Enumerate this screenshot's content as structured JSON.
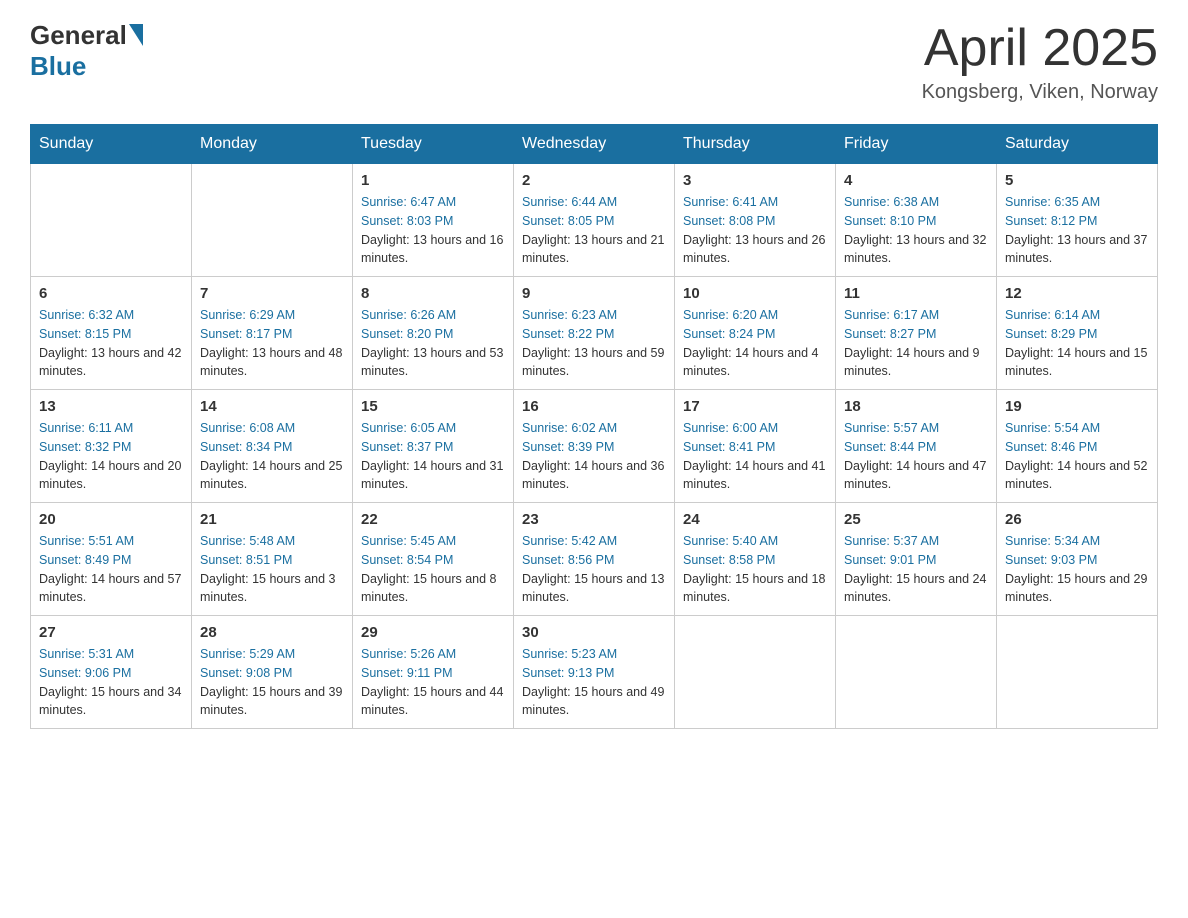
{
  "header": {
    "logo_general": "General",
    "logo_blue": "Blue",
    "month_title": "April 2025",
    "location": "Kongsberg, Viken, Norway"
  },
  "days_of_week": [
    "Sunday",
    "Monday",
    "Tuesday",
    "Wednesday",
    "Thursday",
    "Friday",
    "Saturday"
  ],
  "weeks": [
    [
      {
        "day": "",
        "info": ""
      },
      {
        "day": "",
        "info": ""
      },
      {
        "day": "1",
        "sunrise": "Sunrise: 6:47 AM",
        "sunset": "Sunset: 8:03 PM",
        "daylight": "Daylight: 13 hours and 16 minutes."
      },
      {
        "day": "2",
        "sunrise": "Sunrise: 6:44 AM",
        "sunset": "Sunset: 8:05 PM",
        "daylight": "Daylight: 13 hours and 21 minutes."
      },
      {
        "day": "3",
        "sunrise": "Sunrise: 6:41 AM",
        "sunset": "Sunset: 8:08 PM",
        "daylight": "Daylight: 13 hours and 26 minutes."
      },
      {
        "day": "4",
        "sunrise": "Sunrise: 6:38 AM",
        "sunset": "Sunset: 8:10 PM",
        "daylight": "Daylight: 13 hours and 32 minutes."
      },
      {
        "day": "5",
        "sunrise": "Sunrise: 6:35 AM",
        "sunset": "Sunset: 8:12 PM",
        "daylight": "Daylight: 13 hours and 37 minutes."
      }
    ],
    [
      {
        "day": "6",
        "sunrise": "Sunrise: 6:32 AM",
        "sunset": "Sunset: 8:15 PM",
        "daylight": "Daylight: 13 hours and 42 minutes."
      },
      {
        "day": "7",
        "sunrise": "Sunrise: 6:29 AM",
        "sunset": "Sunset: 8:17 PM",
        "daylight": "Daylight: 13 hours and 48 minutes."
      },
      {
        "day": "8",
        "sunrise": "Sunrise: 6:26 AM",
        "sunset": "Sunset: 8:20 PM",
        "daylight": "Daylight: 13 hours and 53 minutes."
      },
      {
        "day": "9",
        "sunrise": "Sunrise: 6:23 AM",
        "sunset": "Sunset: 8:22 PM",
        "daylight": "Daylight: 13 hours and 59 minutes."
      },
      {
        "day": "10",
        "sunrise": "Sunrise: 6:20 AM",
        "sunset": "Sunset: 8:24 PM",
        "daylight": "Daylight: 14 hours and 4 minutes."
      },
      {
        "day": "11",
        "sunrise": "Sunrise: 6:17 AM",
        "sunset": "Sunset: 8:27 PM",
        "daylight": "Daylight: 14 hours and 9 minutes."
      },
      {
        "day": "12",
        "sunrise": "Sunrise: 6:14 AM",
        "sunset": "Sunset: 8:29 PM",
        "daylight": "Daylight: 14 hours and 15 minutes."
      }
    ],
    [
      {
        "day": "13",
        "sunrise": "Sunrise: 6:11 AM",
        "sunset": "Sunset: 8:32 PM",
        "daylight": "Daylight: 14 hours and 20 minutes."
      },
      {
        "day": "14",
        "sunrise": "Sunrise: 6:08 AM",
        "sunset": "Sunset: 8:34 PM",
        "daylight": "Daylight: 14 hours and 25 minutes."
      },
      {
        "day": "15",
        "sunrise": "Sunrise: 6:05 AM",
        "sunset": "Sunset: 8:37 PM",
        "daylight": "Daylight: 14 hours and 31 minutes."
      },
      {
        "day": "16",
        "sunrise": "Sunrise: 6:02 AM",
        "sunset": "Sunset: 8:39 PM",
        "daylight": "Daylight: 14 hours and 36 minutes."
      },
      {
        "day": "17",
        "sunrise": "Sunrise: 6:00 AM",
        "sunset": "Sunset: 8:41 PM",
        "daylight": "Daylight: 14 hours and 41 minutes."
      },
      {
        "day": "18",
        "sunrise": "Sunrise: 5:57 AM",
        "sunset": "Sunset: 8:44 PM",
        "daylight": "Daylight: 14 hours and 47 minutes."
      },
      {
        "day": "19",
        "sunrise": "Sunrise: 5:54 AM",
        "sunset": "Sunset: 8:46 PM",
        "daylight": "Daylight: 14 hours and 52 minutes."
      }
    ],
    [
      {
        "day": "20",
        "sunrise": "Sunrise: 5:51 AM",
        "sunset": "Sunset: 8:49 PM",
        "daylight": "Daylight: 14 hours and 57 minutes."
      },
      {
        "day": "21",
        "sunrise": "Sunrise: 5:48 AM",
        "sunset": "Sunset: 8:51 PM",
        "daylight": "Daylight: 15 hours and 3 minutes."
      },
      {
        "day": "22",
        "sunrise": "Sunrise: 5:45 AM",
        "sunset": "Sunset: 8:54 PM",
        "daylight": "Daylight: 15 hours and 8 minutes."
      },
      {
        "day": "23",
        "sunrise": "Sunrise: 5:42 AM",
        "sunset": "Sunset: 8:56 PM",
        "daylight": "Daylight: 15 hours and 13 minutes."
      },
      {
        "day": "24",
        "sunrise": "Sunrise: 5:40 AM",
        "sunset": "Sunset: 8:58 PM",
        "daylight": "Daylight: 15 hours and 18 minutes."
      },
      {
        "day": "25",
        "sunrise": "Sunrise: 5:37 AM",
        "sunset": "Sunset: 9:01 PM",
        "daylight": "Daylight: 15 hours and 24 minutes."
      },
      {
        "day": "26",
        "sunrise": "Sunrise: 5:34 AM",
        "sunset": "Sunset: 9:03 PM",
        "daylight": "Daylight: 15 hours and 29 minutes."
      }
    ],
    [
      {
        "day": "27",
        "sunrise": "Sunrise: 5:31 AM",
        "sunset": "Sunset: 9:06 PM",
        "daylight": "Daylight: 15 hours and 34 minutes."
      },
      {
        "day": "28",
        "sunrise": "Sunrise: 5:29 AM",
        "sunset": "Sunset: 9:08 PM",
        "daylight": "Daylight: 15 hours and 39 minutes."
      },
      {
        "day": "29",
        "sunrise": "Sunrise: 5:26 AM",
        "sunset": "Sunset: 9:11 PM",
        "daylight": "Daylight: 15 hours and 44 minutes."
      },
      {
        "day": "30",
        "sunrise": "Sunrise: 5:23 AM",
        "sunset": "Sunset: 9:13 PM",
        "daylight": "Daylight: 15 hours and 49 minutes."
      },
      {
        "day": "",
        "info": ""
      },
      {
        "day": "",
        "info": ""
      },
      {
        "day": "",
        "info": ""
      }
    ]
  ]
}
